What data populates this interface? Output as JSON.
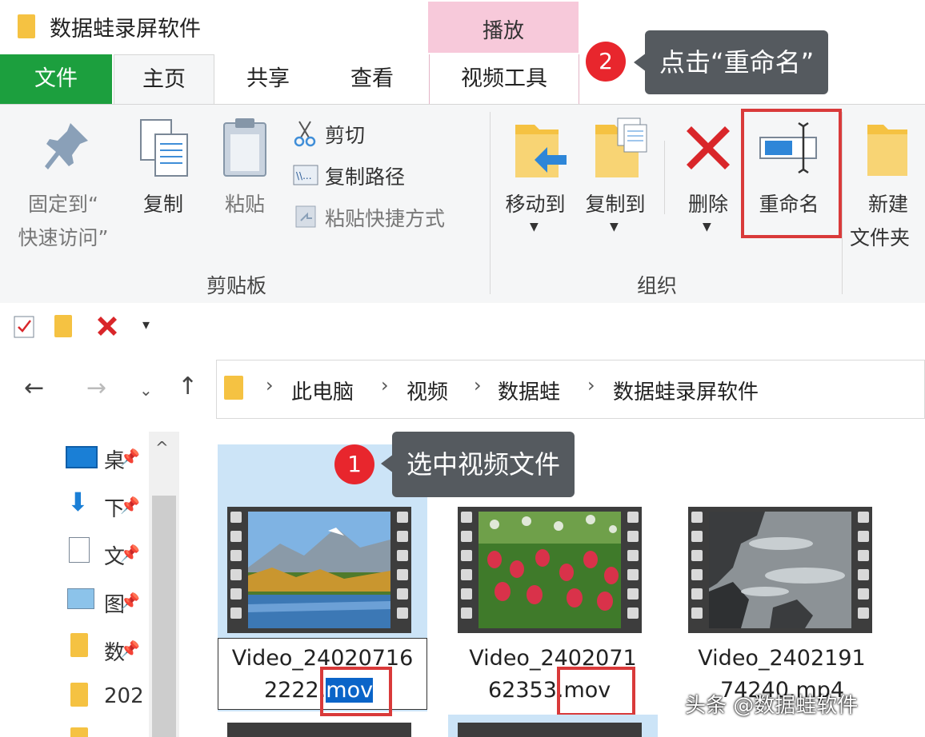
{
  "window": {
    "title": "数据蛙录屏软件",
    "context_tab_header": "播放"
  },
  "tabs": {
    "file": "文件",
    "home": "主页",
    "share": "共享",
    "view": "查看",
    "video_tools": "视频工具"
  },
  "ribbon": {
    "clipboard": {
      "pin_line1": "固定到“",
      "pin_line2": "快速访问”",
      "copy": "复制",
      "paste": "粘贴",
      "cut": "剪切",
      "copy_path": "复制路径",
      "paste_shortcut": "粘贴快捷方式",
      "group_label": "剪贴板"
    },
    "organize": {
      "move_to": "移动到",
      "copy_to": "复制到",
      "delete": "删除",
      "rename": "重命名",
      "group_label": "组织"
    },
    "new": {
      "new_folder_line1": "新建",
      "new_folder_line2": "文件夹"
    }
  },
  "annotations": {
    "step2_badge": "2",
    "step2_text": "点击“重命名”",
    "step1_badge": "1",
    "step1_text": "选中视频文件"
  },
  "address": {
    "crumbs": [
      "此电脑",
      "视频",
      "数据蛙",
      "数据蛙录屏软件"
    ]
  },
  "nav_pane": {
    "items": [
      {
        "label": "桌"
      },
      {
        "label": "下"
      },
      {
        "label": "文"
      },
      {
        "label": "图"
      },
      {
        "label": "数"
      },
      {
        "label": "202"
      }
    ]
  },
  "files": [
    {
      "line1": "Video_24020716",
      "line2_prefix": "2222.",
      "ext": "mov",
      "selected": true
    },
    {
      "line1": "Video_2402071",
      "line2_prefix": "62353",
      "ext": ".mov",
      "selected": false
    },
    {
      "line1": "Video_2402191",
      "line2_prefix": "74240.mp4",
      "ext": "",
      "selected": false
    }
  ],
  "watermark": "头条 @数据蛙软件",
  "colors": {
    "file_tab": "#1c9f3e",
    "context_tab": "#f7c9da",
    "highlight_red": "#d93a3a",
    "selection_blue": "#cce4f7",
    "callout_bg": "#555a5f"
  }
}
